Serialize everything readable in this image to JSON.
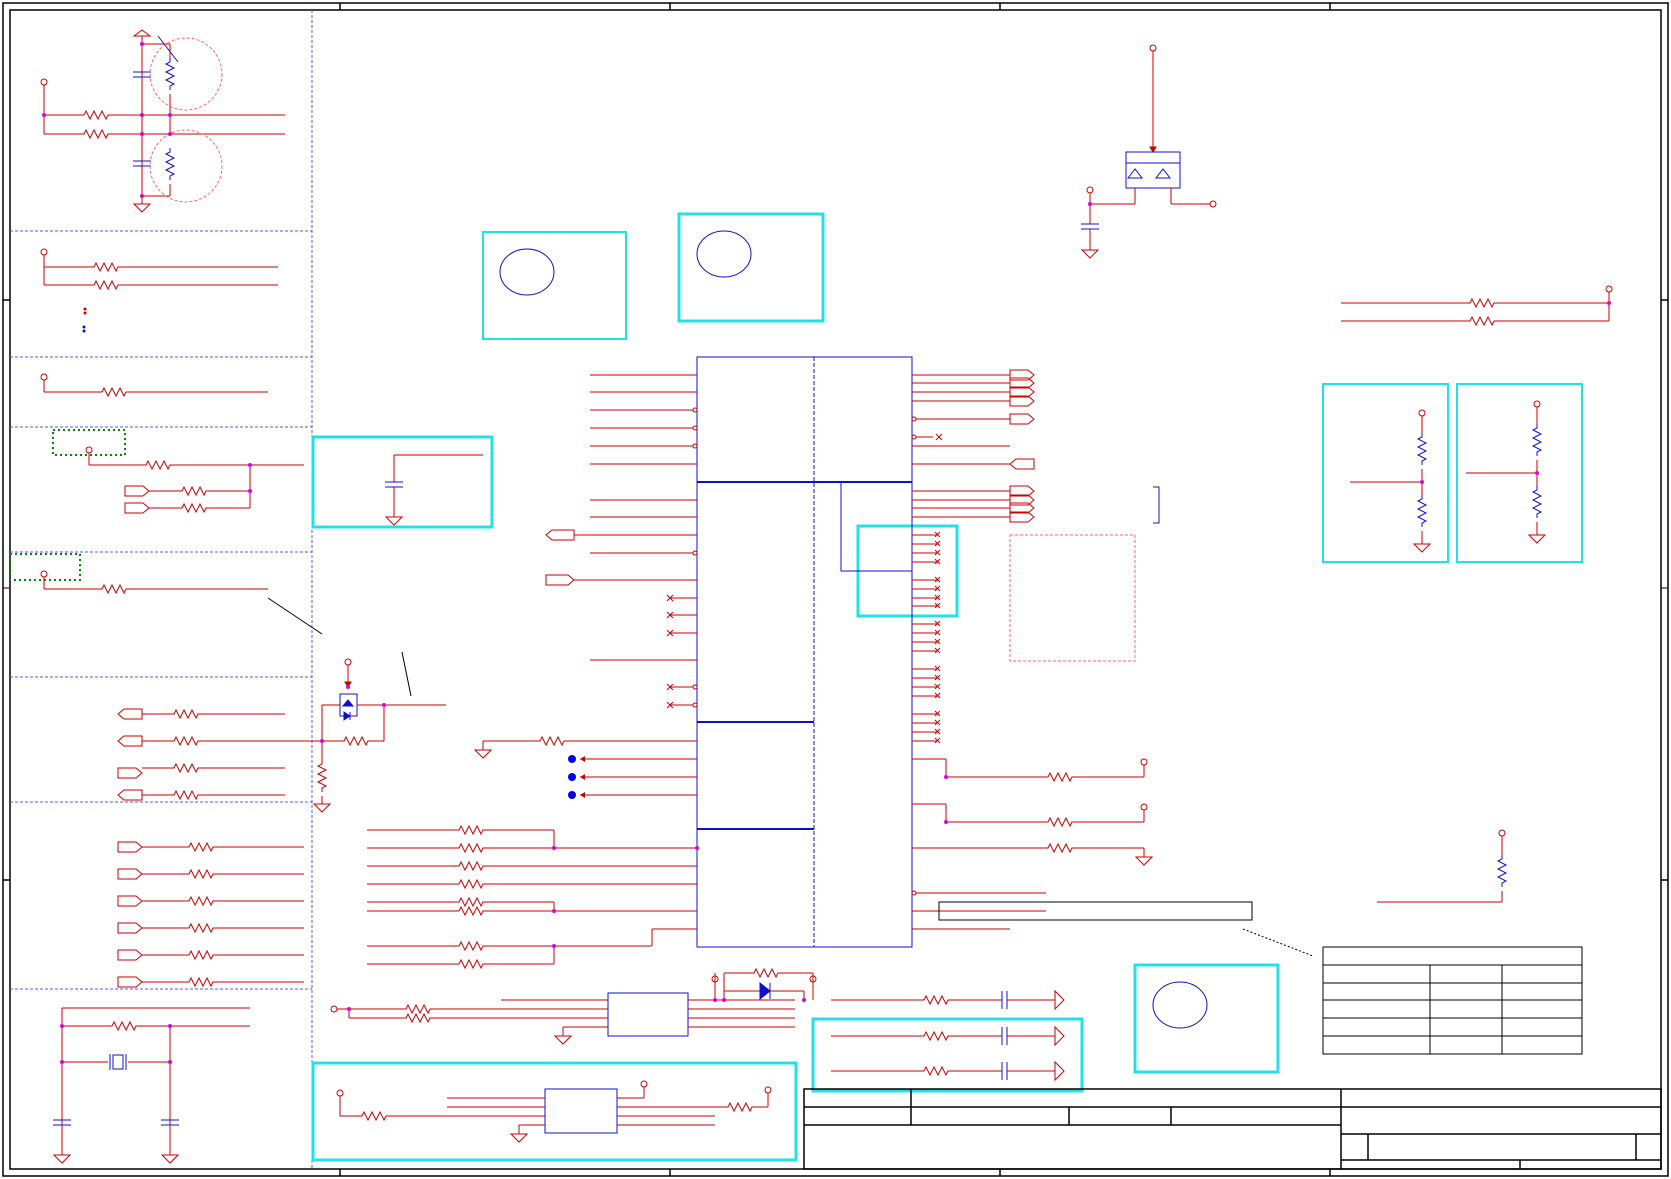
{
  "colors": {
    "wire": "#cc0000",
    "component": "#1010cc",
    "highlight": "#22e0e8",
    "junction": "#dd00dd",
    "section_divider": "#5555ff",
    "frame": "#000000",
    "marker_box": "#008800",
    "keepout": "#ff6666",
    "testpoint": "#0000ee"
  },
  "icons": {
    "power_port": "power-arrow-icon",
    "ground": "ground-symbol-icon",
    "resistor": "resistor-zigzag-icon",
    "capacitor": "capacitor-plates-icon",
    "crystal": "crystal-icon",
    "diode": "diode-icon",
    "mosfet": "mosfet-icon",
    "net_label": "net-flag-icon",
    "no_connect": "no-connect-cross-icon",
    "test_point": "test-point-dot-icon",
    "junction": "junction-dot-icon"
  }
}
